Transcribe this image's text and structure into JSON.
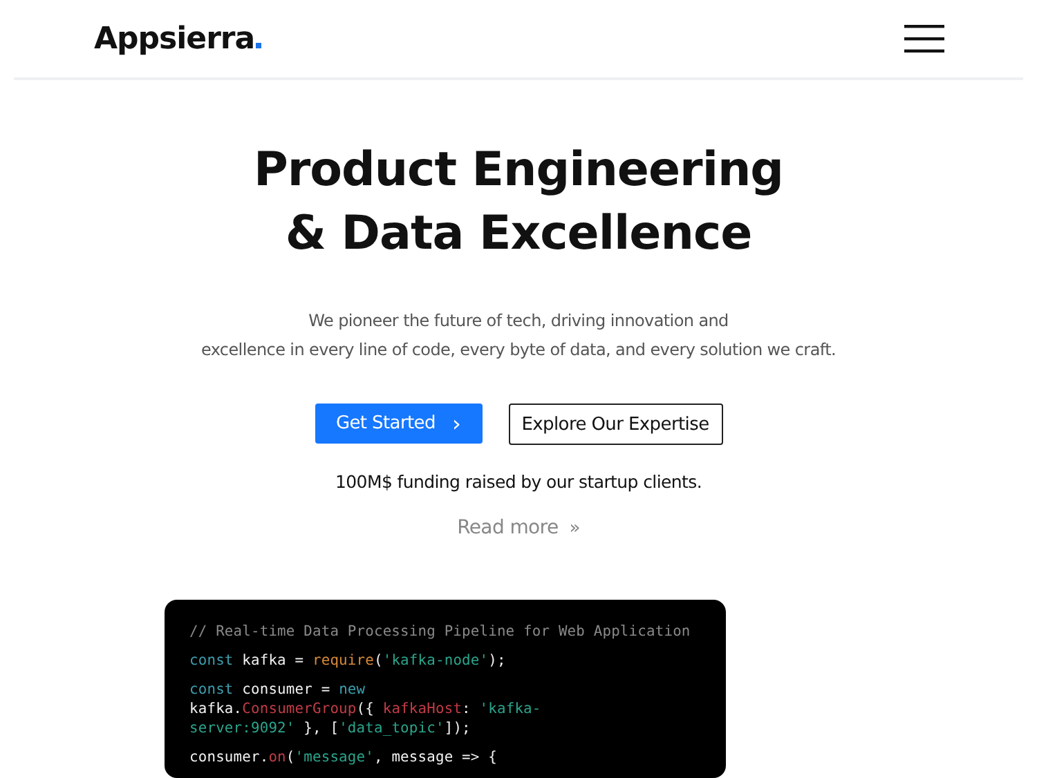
{
  "header": {
    "logo": "Appsierra"
  },
  "hero": {
    "title_lines": [
      "Product Engineering",
      "& Data Excellence"
    ],
    "subtitle_lines": [
      "We pioneer the future of tech, driving innovation and",
      "excellence in every line of code, every byte of data, and every solution we craft."
    ],
    "buttons": [
      {
        "label": "Get Started",
        "kind": "primary",
        "icon": "›"
      },
      {
        "label": "Explore Our Expertise",
        "kind": "outline"
      }
    ],
    "funding": "100M$ funding raised by our startup clients.",
    "read_more": {
      "label": "Read more",
      "icon": "»"
    }
  },
  "code": {
    "blocks": [
      [
        [
          {
            "text": "// Real-time Data Processing Pipeline for Web Application",
            "kind": "comment"
          }
        ]
      ],
      [
        [
          {
            "text": "const",
            "kind": "keyword"
          },
          {
            "text": " kafka = ",
            "kind": "plain"
          },
          {
            "text": "require",
            "kind": "function"
          },
          {
            "text": "(",
            "kind": "plain"
          },
          {
            "text": "'kafka-node'",
            "kind": "string"
          },
          {
            "text": ");",
            "kind": "plain"
          }
        ]
      ],
      [
        [
          {
            "text": "const",
            "kind": "keyword"
          },
          {
            "text": " consumer = ",
            "kind": "plain"
          },
          {
            "text": "new",
            "kind": "keyword"
          }
        ],
        [
          {
            "text": "kafka.",
            "kind": "plain"
          },
          {
            "text": "ConsumerGroup",
            "kind": "property"
          },
          {
            "text": "({ ",
            "kind": "plain"
          },
          {
            "text": "kafkaHost",
            "kind": "property"
          },
          {
            "text": ": ",
            "kind": "plain"
          },
          {
            "text": "'kafka-",
            "kind": "string"
          }
        ],
        [
          {
            "text": "server:9092'",
            "kind": "string"
          },
          {
            "text": " }, [",
            "kind": "plain"
          },
          {
            "text": "'data_topic'",
            "kind": "string"
          },
          {
            "text": "]);",
            "kind": "plain"
          }
        ]
      ],
      [
        [
          {
            "text": "consumer.",
            "kind": "plain"
          },
          {
            "text": "on",
            "kind": "property"
          },
          {
            "text": "(",
            "kind": "plain"
          },
          {
            "text": "'message'",
            "kind": "string"
          },
          {
            "text": ", message => {",
            "kind": "plain"
          }
        ]
      ]
    ]
  }
}
